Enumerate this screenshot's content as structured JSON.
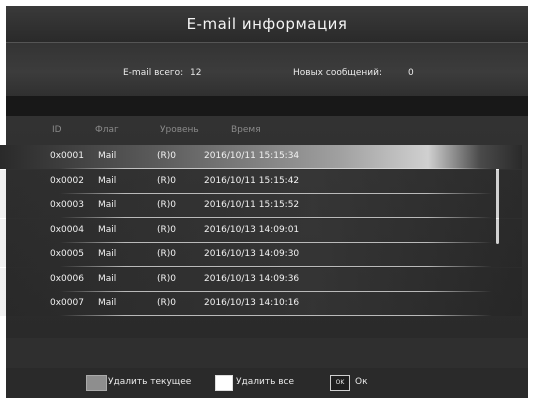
{
  "title": "E-mail информация",
  "summary": {
    "total_label": "E-mail всего:",
    "total_value": "12",
    "new_label": "Новых сообщений:",
    "new_value": "0"
  },
  "columns": [
    "ID",
    "Флаг",
    "Уровень",
    "Время"
  ],
  "rows": [
    {
      "id": "0x0001",
      "flag": "Mail",
      "level": "(R)0",
      "time": "2016/10/11 15:15:34"
    },
    {
      "id": "0x0002",
      "flag": "Mail",
      "level": "(R)0",
      "time": "2016/10/11 15:15:42"
    },
    {
      "id": "0x0003",
      "flag": "Mail",
      "level": "(R)0",
      "time": "2016/10/11 15:15:52"
    },
    {
      "id": "0x0004",
      "flag": "Mail",
      "level": "(R)0",
      "time": "2016/10/13 14:09:01"
    },
    {
      "id": "0x0005",
      "flag": "Mail",
      "level": "(R)0",
      "time": "2016/10/13 14:09:30"
    },
    {
      "id": "0x0006",
      "flag": "Mail",
      "level": "(R)0",
      "time": "2016/10/13 14:09:36"
    },
    {
      "id": "0x0007",
      "flag": "Mail",
      "level": "(R)0",
      "time": "2016/10/13 14:10:16"
    }
  ],
  "selected_row": 0,
  "footer": {
    "delete_current_label": "Удалить текущее",
    "delete_all_label": "Удалить все",
    "ok_key": "OK",
    "ok_label": "Ок"
  },
  "colors": {
    "background": "#2f2f2f",
    "text": "#f2f2f2",
    "header_text": "#8a8a8a",
    "key_gray": "#8e8e8e",
    "key_white": "#ffffff"
  },
  "icons": {
    "delete_current": "gray-key-icon",
    "delete_all": "white-key-icon",
    "ok": "ok-key-icon"
  }
}
